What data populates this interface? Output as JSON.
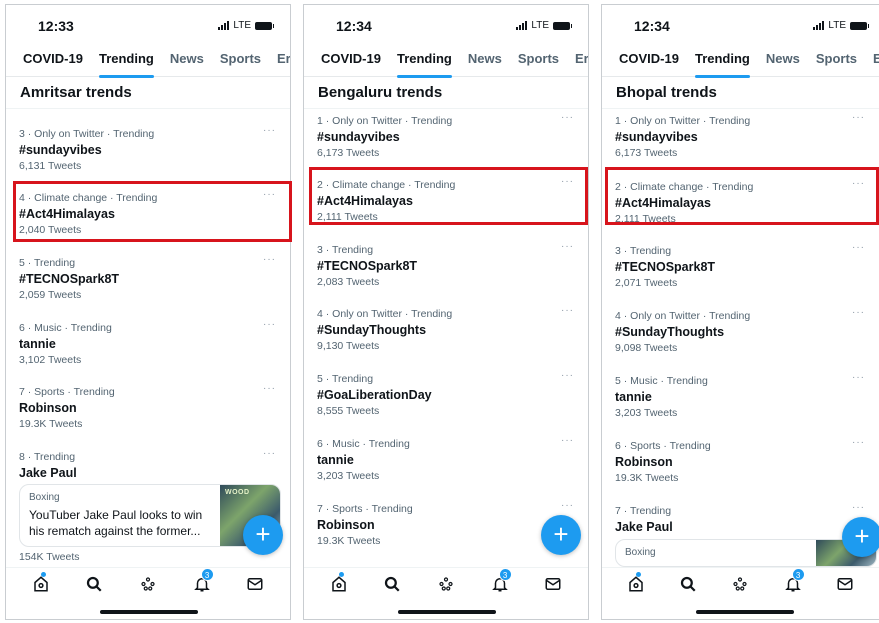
{
  "tabs": [
    "COVID-19",
    "Trending",
    "News",
    "Sports",
    "Er"
  ],
  "active_tab_index": 1,
  "accent_color": "#1d9bf0",
  "highlight_color": "#d7141c",
  "network": "LTE",
  "fab_label": "+",
  "notification_badge": "3",
  "tweets_suffix": "Tweets",
  "nav_icons": [
    "home-icon",
    "search-icon",
    "spaces-icon",
    "notifications-icon",
    "messages-icon"
  ],
  "screens": [
    {
      "time": "12:33",
      "section_title": "Amritsar trends",
      "trends": [
        {
          "meta": "3 · Only on Twitter · Trending",
          "name": "#sundayvibes",
          "count": "6,131 Tweets"
        },
        {
          "meta": "4 · Climate change · Trending",
          "name": "#Act4Himalayas",
          "count": "2,040 Tweets"
        },
        {
          "meta": "5 · Trending",
          "name": "#TECNOSpark8T",
          "count": "2,059 Tweets"
        },
        {
          "meta": "6 · Music · Trending",
          "name": "tannie",
          "count": "3,102 Tweets"
        },
        {
          "meta": "7 · Sports · Trending",
          "name": "Robinson",
          "count": "19.3K Tweets"
        },
        {
          "meta": "8 · Trending",
          "name": "Jake Paul",
          "count": "154K Tweets"
        }
      ],
      "news": {
        "category": "Boxing",
        "headline": "YouTuber Jake Paul looks to win his rematch against the former...",
        "thumb_text": "WOOD"
      }
    },
    {
      "time": "12:34",
      "section_title": "Bengaluru trends",
      "trends": [
        {
          "meta": "1 · Only on Twitter · Trending",
          "name": "#sundayvibes",
          "count": "6,173 Tweets"
        },
        {
          "meta": "2 · Climate change · Trending",
          "name": "#Act4Himalayas",
          "count": "2,111 Tweets"
        },
        {
          "meta": "3 · Trending",
          "name": "#TECNOSpark8T",
          "count": "2,083 Tweets"
        },
        {
          "meta": "4 · Only on Twitter · Trending",
          "name": "#SundayThoughts",
          "count": "9,130 Tweets"
        },
        {
          "meta": "5 · Trending",
          "name": "#GoaLiberationDay",
          "count": "8,555 Tweets"
        },
        {
          "meta": "6 · Music · Trending",
          "name": "tannie",
          "count": "3,203 Tweets"
        },
        {
          "meta": "7 · Sports · Trending",
          "name": "Robinson",
          "count": "19.3K Tweets"
        }
      ]
    },
    {
      "time": "12:34",
      "section_title": "Bhopal trends",
      "trends": [
        {
          "meta": "1 · Only on Twitter · Trending",
          "name": "#sundayvibes",
          "count": "6,173 Tweets"
        },
        {
          "meta": "2 · Climate change · Trending",
          "name": "#Act4Himalayas",
          "count": "2,111 Tweets"
        },
        {
          "meta": "3 · Trending",
          "name": "#TECNOSpark8T",
          "count": "2,071 Tweets"
        },
        {
          "meta": "4 · Only on Twitter · Trending",
          "name": "#SundayThoughts",
          "count": "9,098 Tweets"
        },
        {
          "meta": "5 · Music · Trending",
          "name": "tannie",
          "count": "3,203 Tweets"
        },
        {
          "meta": "6 · Sports · Trending",
          "name": "Robinson",
          "count": "19.3K Tweets"
        },
        {
          "meta": "7 · Trending",
          "name": "Jake Paul",
          "count": ""
        }
      ],
      "news": {
        "category": "Boxing",
        "headline": "",
        "thumb_text": ""
      }
    }
  ]
}
